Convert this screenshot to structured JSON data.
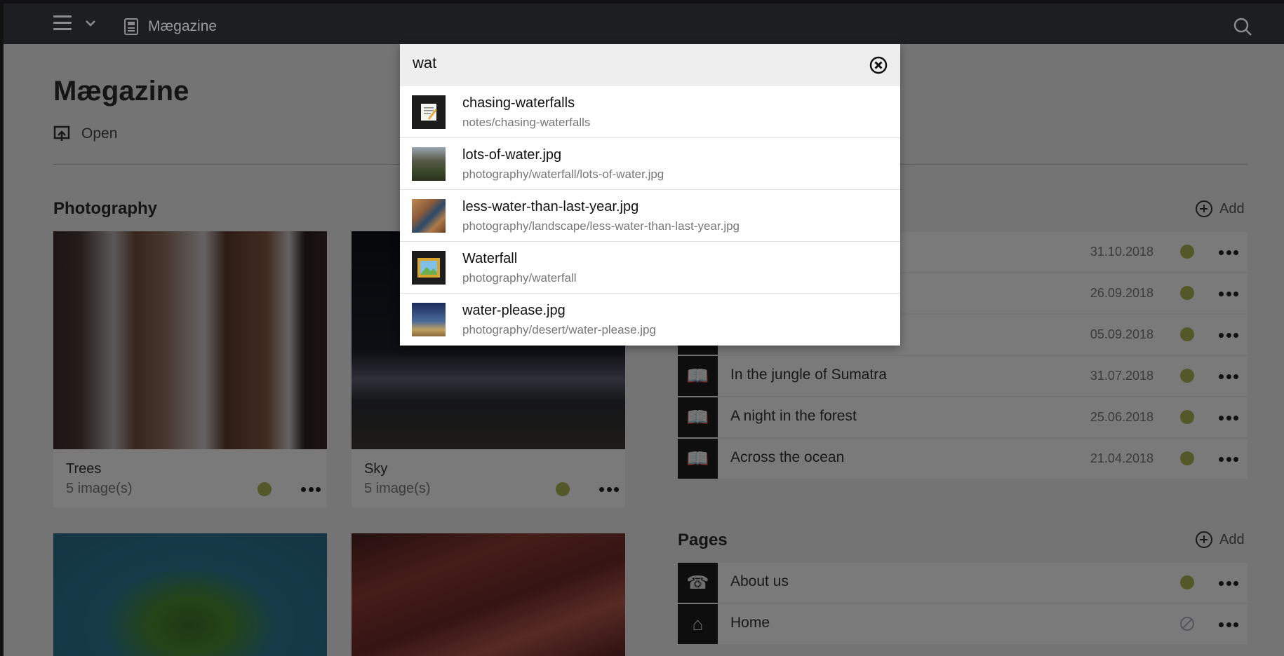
{
  "topbar": {
    "title": "Mægazine"
  },
  "page": {
    "title": "Mægazine",
    "open_label": "Open",
    "photography": {
      "title": "Photography",
      "cards": [
        {
          "title": "Trees",
          "subtitle": "5 image(s)"
        },
        {
          "title": "Sky",
          "subtitle": "5 image(s)"
        }
      ]
    },
    "add_label": "Add",
    "notes": [
      {
        "label": "",
        "date": "31.10.2018"
      },
      {
        "label": "",
        "date": "26.09.2018"
      },
      {
        "label": "",
        "date": "05.09.2018"
      },
      {
        "label": "In the jungle of Sumatra",
        "date": "31.07.2018"
      },
      {
        "label": "A night in the forest",
        "date": "25.06.2018"
      },
      {
        "label": "Across the ocean",
        "date": "21.04.2018"
      }
    ],
    "pages": {
      "title": "Pages",
      "items": [
        {
          "label": "About us",
          "icon": "phone-icon"
        },
        {
          "label": "Home",
          "icon": "house-icon"
        }
      ]
    }
  },
  "search": {
    "query": "wat",
    "results": [
      {
        "name": "chasing-waterfalls",
        "path": "notes/chasing-waterfalls",
        "icon": "memo-icon"
      },
      {
        "name": "lots-of-water.jpg",
        "path": "photography/waterfall/lots-of-water.jpg"
      },
      {
        "name": "less-water-than-last-year.jpg",
        "path": "photography/landscape/less-water-than-last-year.jpg"
      },
      {
        "name": "Waterfall",
        "path": "photography/waterfall",
        "icon": "framed-picture-icon"
      },
      {
        "name": "water-please.jpg",
        "path": "photography/desert/water-please.jpg"
      }
    ]
  },
  "colors": {
    "status_published": "#a5b150",
    "topbar": "#1d1e22"
  }
}
